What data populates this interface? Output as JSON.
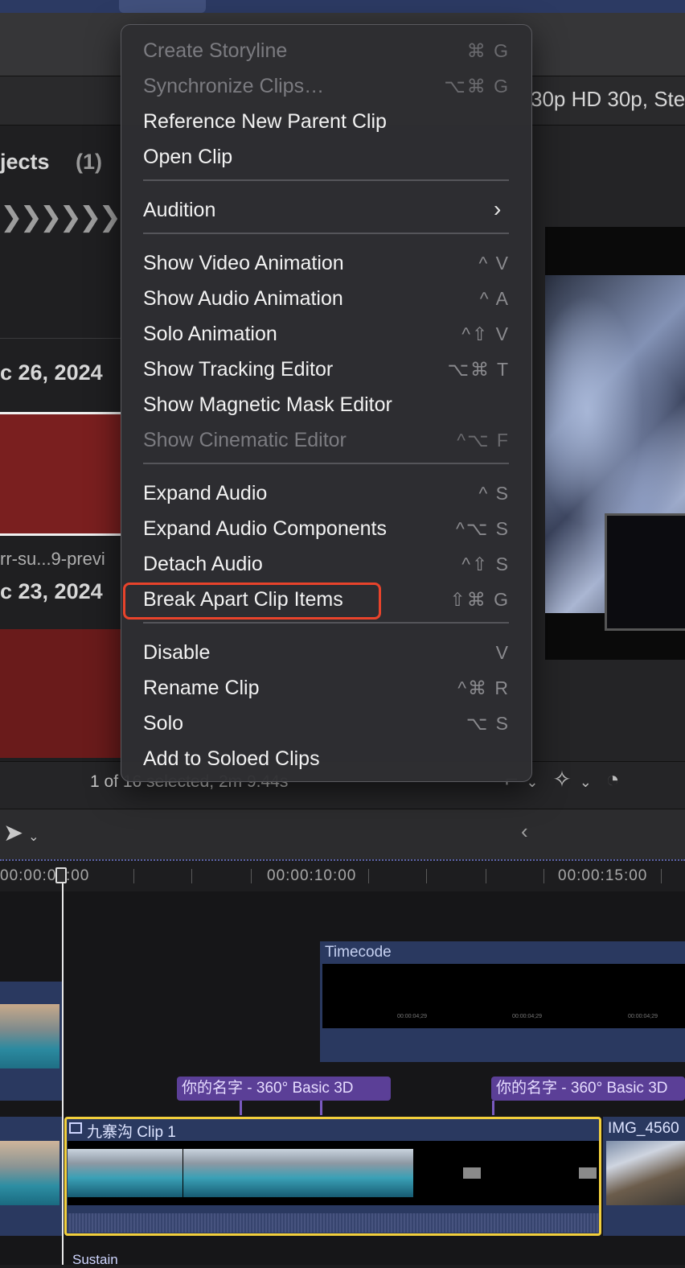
{
  "viewer": {
    "format": "30p HD 30p, Ste"
  },
  "browser": {
    "projects_label": "jects",
    "projects_count": "(1)",
    "chevrons": "❯❯❯❯❯❯",
    "date1": "c 26, 2024",
    "clip_caption": "rr-su...9-previ",
    "date2": "c 23, 2024"
  },
  "status": {
    "selection": "1 of 16 selected, 2m 9.44s"
  },
  "timeline": {
    "ruler": [
      "00:00:05:00",
      "00:00:10:00",
      "00:00:15:00"
    ],
    "timecode_clip": "Timecode",
    "timecode_mini": "00:00:04;29",
    "title_clips": [
      "你的名字 - 360° Basic 3D",
      "你的名字 - 360° Basic 3D"
    ],
    "main_clip": "九寨沟 Clip 1",
    "next_clip": "IMG_4560",
    "bottom_label": "Sustain"
  },
  "context_menu": {
    "groups": [
      [
        {
          "label": "Create Storyline",
          "shortcut": "⌘ G",
          "disabled": true
        },
        {
          "label": "Synchronize Clips…",
          "shortcut": "⌥⌘ G",
          "disabled": true
        },
        {
          "label": "Reference New Parent Clip",
          "shortcut": "",
          "disabled": false
        },
        {
          "label": "Open Clip",
          "shortcut": "",
          "disabled": false
        }
      ],
      [
        {
          "label": "Audition",
          "shortcut": "",
          "disabled": false,
          "submenu": true
        }
      ],
      [
        {
          "label": "Show Video Animation",
          "shortcut": "^ V",
          "disabled": false
        },
        {
          "label": "Show Audio Animation",
          "shortcut": "^ A",
          "disabled": false
        },
        {
          "label": "Solo Animation",
          "shortcut": "^⇧ V",
          "disabled": false
        },
        {
          "label": "Show Tracking Editor",
          "shortcut": "⌥⌘ T",
          "disabled": false
        },
        {
          "label": "Show Magnetic Mask Editor",
          "shortcut": "",
          "disabled": false
        },
        {
          "label": "Show Cinematic Editor",
          "shortcut": "^⌥ F",
          "disabled": true
        }
      ],
      [
        {
          "label": "Expand Audio",
          "shortcut": "^ S",
          "disabled": false
        },
        {
          "label": "Expand Audio Components",
          "shortcut": "^⌥ S",
          "disabled": false
        },
        {
          "label": "Detach Audio",
          "shortcut": "^⇧ S",
          "disabled": false
        },
        {
          "label": "Break Apart Clip Items",
          "shortcut": "⇧⌘ G",
          "disabled": false,
          "highlighted": true
        }
      ],
      [
        {
          "label": "Disable",
          "shortcut": "V",
          "disabled": false
        },
        {
          "label": "Rename Clip",
          "shortcut": "^⌘ R",
          "disabled": false
        },
        {
          "label": "Solo",
          "shortcut": "⌥ S",
          "disabled": false
        },
        {
          "label": "Add to Soloed Clips",
          "shortcut": "",
          "disabled": false
        }
      ]
    ]
  },
  "icons": {
    "select_tool": "arrow-pointer-icon",
    "chevron_down": "chevron-down-icon",
    "back": "chevron-left-icon",
    "crop": "crop-icon",
    "enhance": "magic-wand-icon",
    "speed": "speed-gauge-icon"
  },
  "colors": {
    "menubar": "#2c3a63",
    "selection_outline": "#f2cf3c",
    "highlight_box": "#e8432b",
    "title_clip": "#5b3f97",
    "clip_blue": "#2a3960"
  }
}
